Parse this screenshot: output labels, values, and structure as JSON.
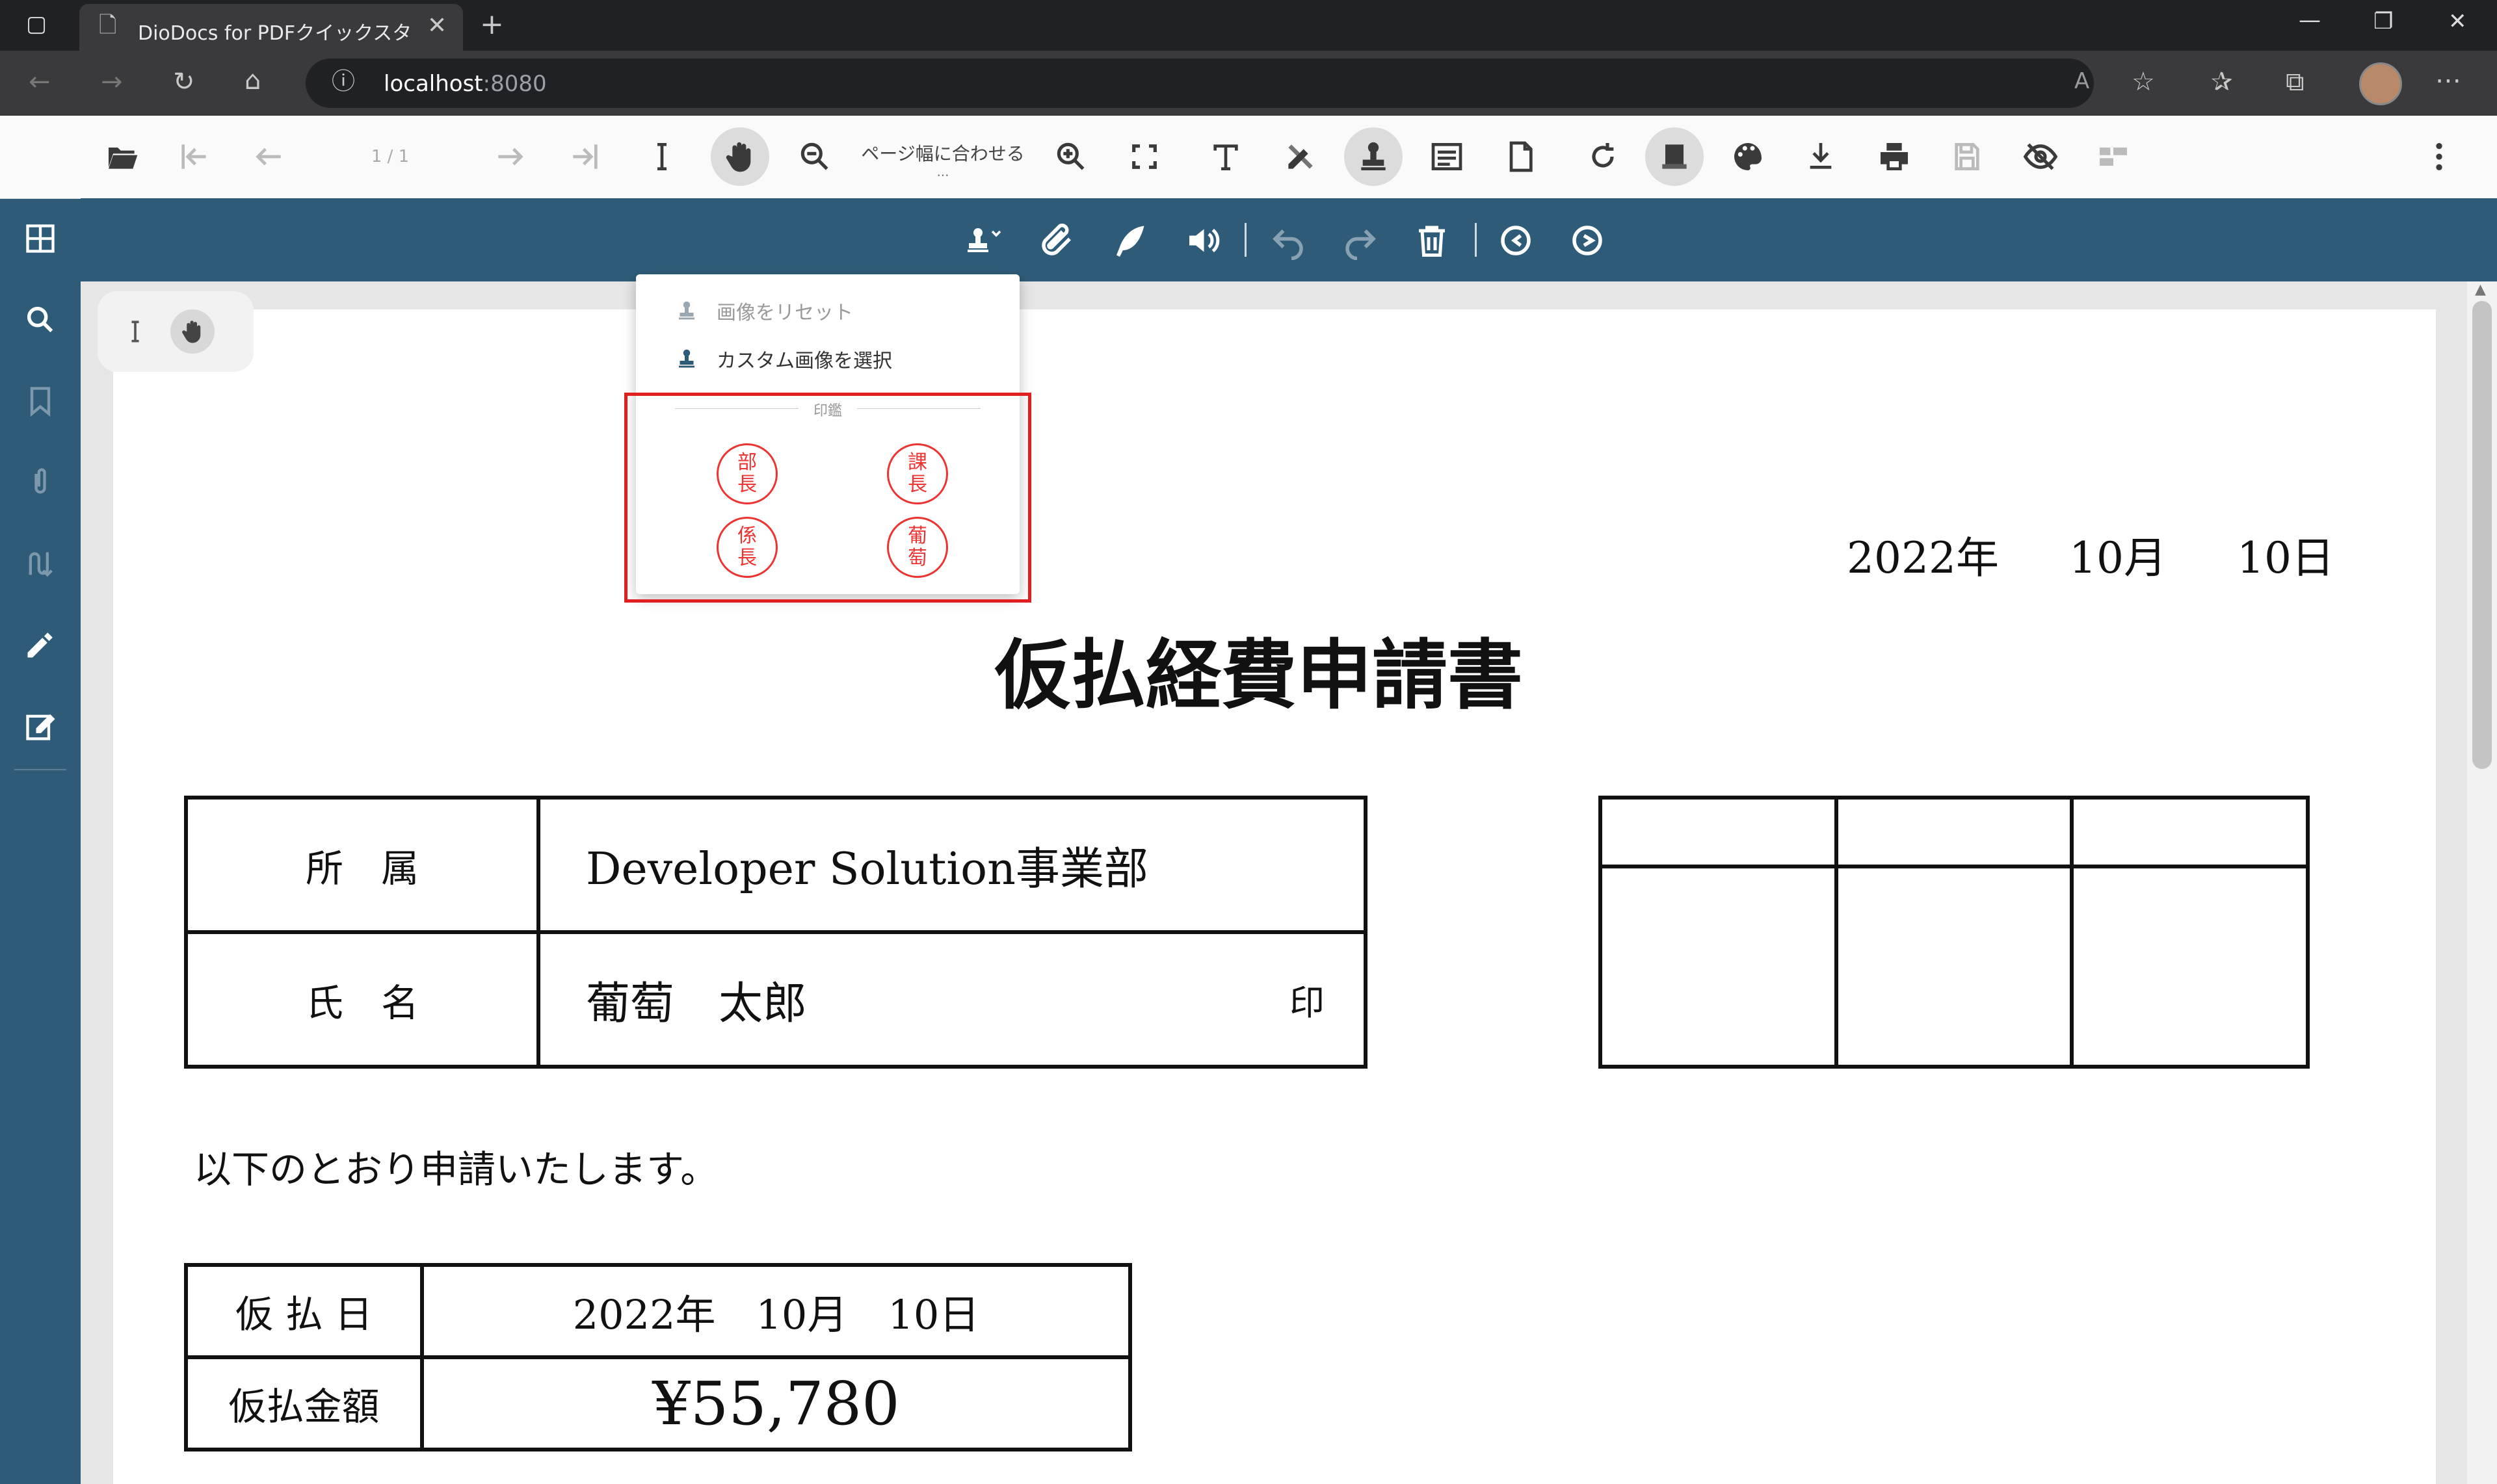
{
  "browser": {
    "tab_title": "DioDocs for PDFクイックスタート | P",
    "url_host": "localhost",
    "url_port": ":8080"
  },
  "toolbar": {
    "page_indicator": "1 / 1",
    "zoom_label": "ページ幅に合わせる",
    "zoom_more": "..."
  },
  "stamp_menu": {
    "reset_label": "画像をリセット",
    "custom_label": "カスタム画像を選択",
    "group_label": "印鑑",
    "stamps": [
      {
        "top": "部",
        "bottom": "長"
      },
      {
        "top": "課",
        "bottom": "長"
      },
      {
        "top": "係",
        "bottom": "長"
      },
      {
        "top": "葡",
        "bottom": "萄"
      }
    ]
  },
  "document": {
    "date": {
      "year": "2022年",
      "month": "10月",
      "day": "10日"
    },
    "title": "仮払経費申請書",
    "affiliation_label": "所　属",
    "affiliation_value": "Developer Solution事業部",
    "name_label": "氏　名",
    "name_value": "葡萄　太郎",
    "seal_label": "印",
    "intro": "以下のとおり申請いたします。",
    "advance_date_label": "仮 払 日",
    "advance_date_value": "2022年　10月　10日",
    "amount_label": "仮払金額",
    "amount_value": "¥55,780"
  }
}
